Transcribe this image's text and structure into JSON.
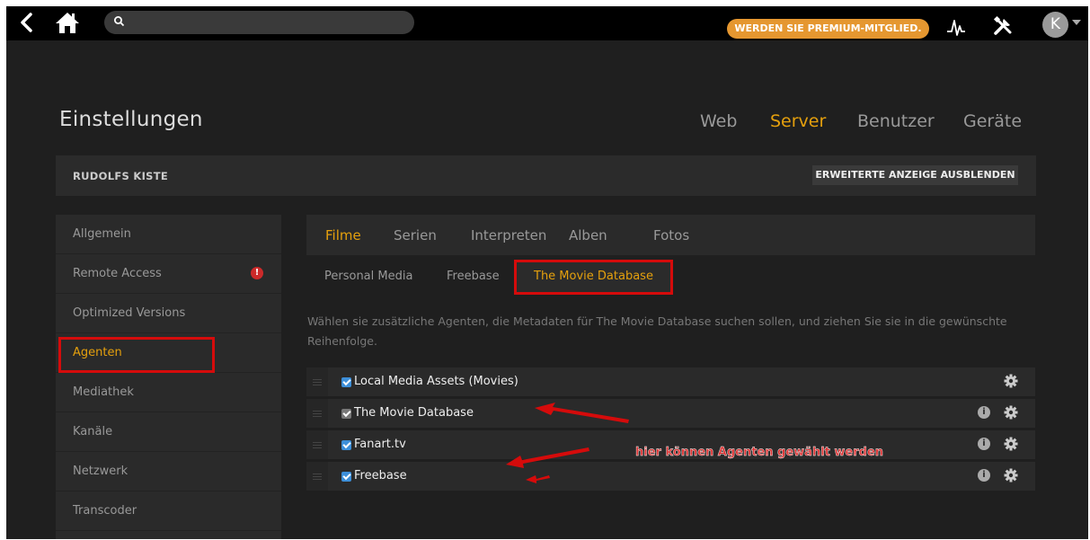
{
  "topbar": {
    "premium_label": "WERDEN SIE PREMIUM-MITGLIED.",
    "avatar_letter": "K"
  },
  "header": {
    "title": "Einstellungen",
    "tabs": [
      {
        "label": "Web",
        "active": false
      },
      {
        "label": "Server",
        "active": true
      },
      {
        "label": "Benutzer",
        "active": false
      },
      {
        "label": "Geräte",
        "active": false
      }
    ]
  },
  "server_bar": {
    "name": "RUDOLFS KISTE",
    "toggle_label": "ERWEITERTE ANZEIGE AUSBLENDEN"
  },
  "sidebar": {
    "items": [
      {
        "label": "Allgemein"
      },
      {
        "label": "Remote Access",
        "alert": "!"
      },
      {
        "label": "Optimized Versions"
      },
      {
        "label": "Agenten",
        "active": true
      },
      {
        "label": "Mediathek"
      },
      {
        "label": "Kanäle"
      },
      {
        "label": "Netzwerk"
      },
      {
        "label": "Transcoder"
      }
    ]
  },
  "media_tabs": [
    {
      "label": "Filme",
      "active": true
    },
    {
      "label": "Serien"
    },
    {
      "label": "Interpreten"
    },
    {
      "label": "Alben"
    },
    {
      "label": "Fotos"
    }
  ],
  "sub_tabs": [
    {
      "label": "Personal Media"
    },
    {
      "label": "Freebase"
    },
    {
      "label": "The Movie Database",
      "active": true
    }
  ],
  "description": "Wählen sie zusätzliche Agenten, die Metadaten für The Movie Database suchen sollen, und ziehen Sie sie in die gewünschte Reihenfolge.",
  "agents": [
    {
      "name": "Local Media Assets (Movies)",
      "checked": true,
      "info": false
    },
    {
      "name": "The Movie Database",
      "checked": true,
      "locked": true,
      "info": true
    },
    {
      "name": "Fanart.tv",
      "checked": true,
      "info": true
    },
    {
      "name": "Freebase",
      "checked": true,
      "info": true
    }
  ],
  "annotation": {
    "text": "hier können Agenten gewählt werden",
    "color": "#d50b0b"
  },
  "colors": {
    "accent": "#e5a00d",
    "premium": "#e59730",
    "checkbox": "#3d8fd9"
  }
}
